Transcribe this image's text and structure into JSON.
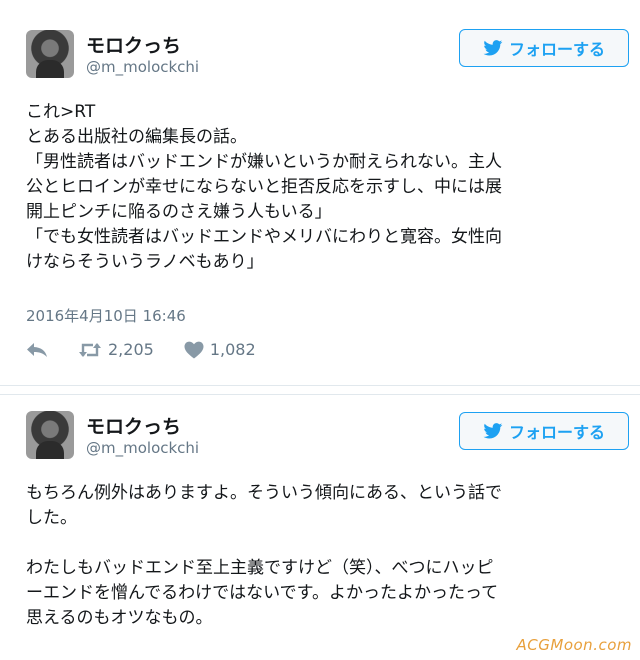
{
  "tweets": [
    {
      "display_name": "モロクっち",
      "handle": "@m_molockchi",
      "follow_label": "フォローする",
      "body_lines": [
        "これ>RT",
        "とある出版社の編集長の話。",
        "「男性読者はバッドエンドが嫌いというか耐えられない。主人",
        "公とヒロインが幸せにならないと拒否反応を示すし、中には展",
        "開上ピンチに陥るのさえ嫌う人もいる」",
        "「でも女性読者はバッドエンドやメリバにわりと寛容。女性向",
        "けならそういうラノベもあり」"
      ],
      "timestamp": "2016年4月10日 16:46",
      "retweets": "2,205",
      "likes": "1,082"
    },
    {
      "display_name": "モロクっち",
      "handle": "@m_molockchi",
      "follow_label": "フォローする",
      "body_lines": [
        "もちろん例外はありますよ。そういう傾向にある、という話で",
        "した。",
        "",
        "わたしもバッドエンド至上主義ですけど（笑）、べつにハッピ",
        "ーエンドを憎んでるわけではないです。よかったよかったって",
        "思えるのもオツなもの。"
      ]
    }
  ],
  "watermark": "ACGMoon.com",
  "colors": {
    "accent": "#1da1f2",
    "meta": "#657786",
    "text": "#14171a"
  }
}
